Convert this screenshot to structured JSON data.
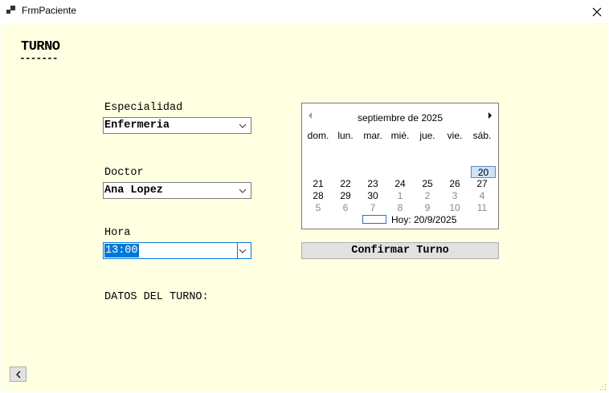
{
  "window": {
    "title": "FrmPaciente"
  },
  "form": {
    "heading": "TURNO",
    "heading_underline": "-------",
    "especialidad": {
      "label": "Especialidad",
      "value": "Enfermeria"
    },
    "doctor": {
      "label": "Doctor",
      "value": "Ana Lopez"
    },
    "hora": {
      "label": "Hora",
      "value": "13:00"
    },
    "confirm_label": "Confirmar Turno",
    "datos_label": "DATOS DEL TURNO:"
  },
  "calendar": {
    "month_label": "septiembre de 2025",
    "weekdays": [
      "dom.",
      "lun.",
      "mar.",
      "mié.",
      "jue.",
      "vie.",
      "sáb."
    ],
    "weeks": [
      [
        {
          "d": "21"
        },
        {
          "d": "22"
        },
        {
          "d": "23"
        },
        {
          "d": "24"
        },
        {
          "d": "25"
        },
        {
          "d": "26"
        },
        {
          "d": "27"
        }
      ],
      [
        {
          "d": "28"
        },
        {
          "d": "29"
        },
        {
          "d": "30"
        },
        {
          "d": "1",
          "o": true
        },
        {
          "d": "2",
          "o": true
        },
        {
          "d": "3",
          "o": true
        },
        {
          "d": "4",
          "o": true
        }
      ],
      [
        {
          "d": "5",
          "o": true
        },
        {
          "d": "6",
          "o": true
        },
        {
          "d": "7",
          "o": true
        },
        {
          "d": "8",
          "o": true
        },
        {
          "d": "9",
          "o": true
        },
        {
          "d": "10",
          "o": true
        },
        {
          "d": "11",
          "o": true
        }
      ]
    ],
    "selected_day": "20",
    "today_label": "Hoy: 20/9/2025"
  },
  "colors": {
    "form_background": "#ffffe1",
    "selection": "#0078d7",
    "button_face": "#e1e1e1"
  }
}
